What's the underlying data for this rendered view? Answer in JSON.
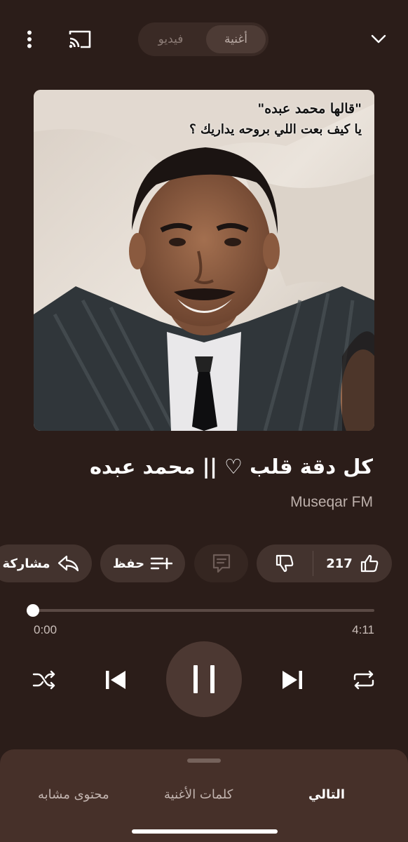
{
  "header": {
    "tabs": [
      {
        "label": "أغنية",
        "active": true
      },
      {
        "label": "فيديو",
        "active": false
      }
    ],
    "icons": [
      "more-vert-icon",
      "cast-icon",
      "chevron-down-icon"
    ]
  },
  "song": {
    "art_caption_line1": "\"قالها محمد عبده\"",
    "art_caption_line2": "يا كيف بعت اللي بروحه يداريك ؟",
    "title": "كل دقة قلب ♡ || محمد عبده",
    "artist": "Museqar FM"
  },
  "actions": {
    "share_label": "مشاركة",
    "save_label": "حفظ",
    "likes_count": "217"
  },
  "playback": {
    "current_time": "0:00",
    "duration": "4:11",
    "progress": 0.0,
    "state": "playing"
  },
  "sheet": {
    "tabs": [
      {
        "label": "التالي",
        "active": true
      },
      {
        "label": "كلمات الأغنية",
        "active": false
      },
      {
        "label": "محتوى مشابه",
        "active": false
      }
    ]
  },
  "colors": {
    "background": "#2b1d19",
    "pill": "#43332e",
    "play_button": "#4c3832",
    "sheet": "#463029"
  }
}
